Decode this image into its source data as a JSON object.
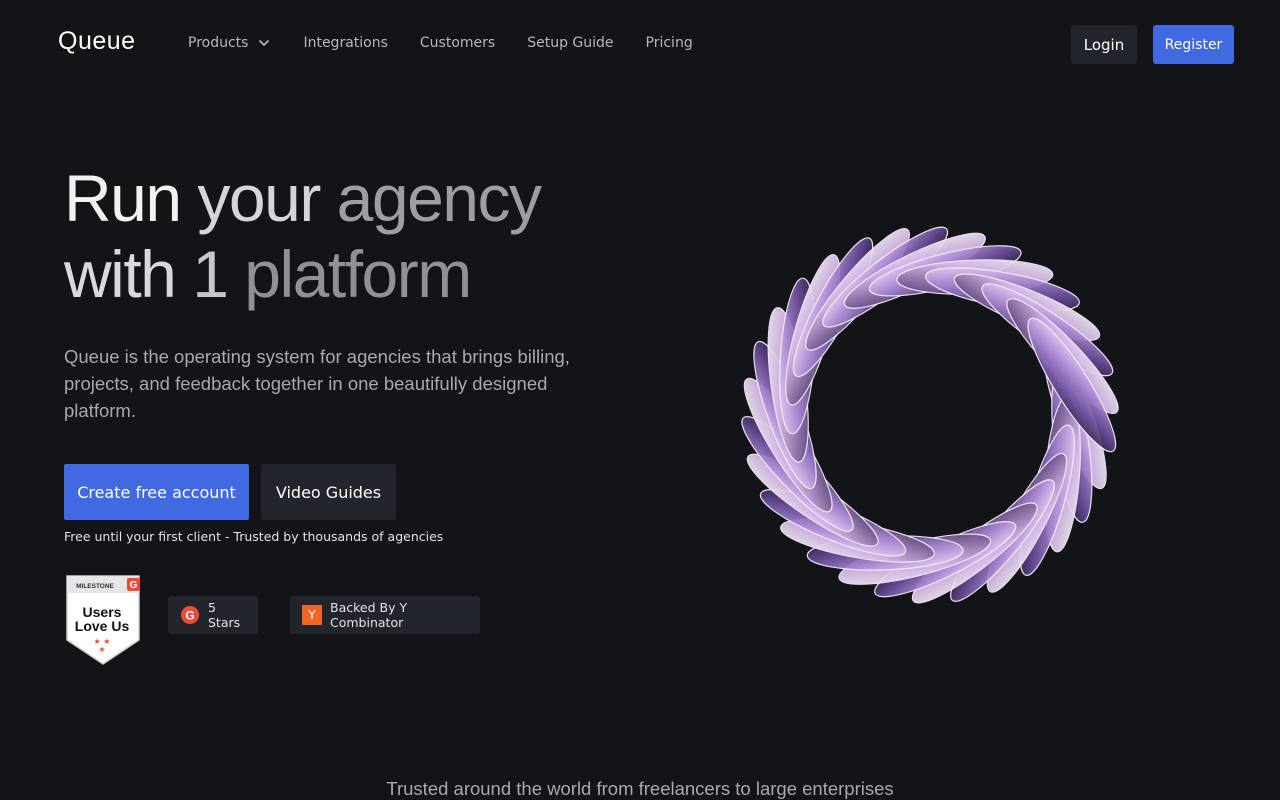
{
  "brand": {
    "name": "Queue"
  },
  "nav": {
    "items": [
      {
        "label": "Products",
        "has_dropdown": true,
        "icon": "chevron-down-icon"
      },
      {
        "label": "Integrations"
      },
      {
        "label": "Customers"
      },
      {
        "label": "Setup Guide"
      },
      {
        "label": "Pricing"
      }
    ],
    "login_label": "Login",
    "register_label": "Register"
  },
  "hero": {
    "title_line1": [
      "Run",
      "your",
      "agency"
    ],
    "title_line2": [
      "with",
      "1",
      "platform"
    ],
    "description": "Queue is the operating system for agencies that brings billing, projects, and feedback together in one beautifully designed platform.",
    "primary_cta": "Create free account",
    "secondary_cta": "Video Guides",
    "note": "Free until your first client - Trusted by thousands of agencies"
  },
  "badges": {
    "g2_badge": {
      "top": "MILESTONE",
      "line1": "Users",
      "line2": "Love Us"
    },
    "stars_label": "5 Stars",
    "yc_label": "Backed By Y Combinator",
    "yc_letter": "Y"
  },
  "trust_text": "Trusted around the world from freelancers to large enterprises",
  "colors": {
    "background": "#131417",
    "accent": "#4169e1",
    "surface": "#22252b",
    "yc_orange": "#f26625",
    "g2_red": "#ef4a36"
  }
}
